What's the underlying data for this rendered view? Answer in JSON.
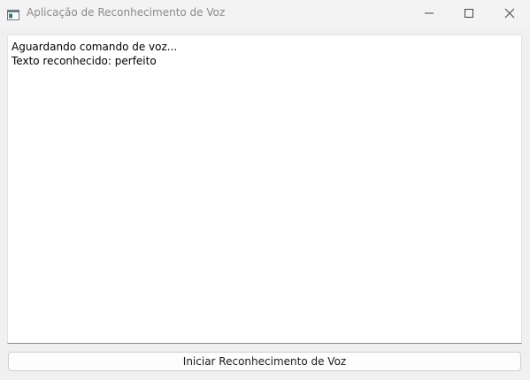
{
  "window": {
    "title": "Aplicação de Reconhecimento de Voz",
    "app_icon": "window-app-icon",
    "controls": {
      "minimize_icon": "minimize-icon",
      "maximize_icon": "maximize-icon",
      "close_icon": "close-icon"
    }
  },
  "output": {
    "lines": [
      "Aguardando comando de voz...",
      "Texto reconhecido: perfeito"
    ]
  },
  "actions": {
    "start_label": "Iniciar Reconhecimento de Voz"
  },
  "colors": {
    "titlebar_bg": "#f3f3f3",
    "title_text": "#8a8a8a",
    "content_bg": "#ffffff",
    "app_icon_accent": "#2e7d7a"
  }
}
